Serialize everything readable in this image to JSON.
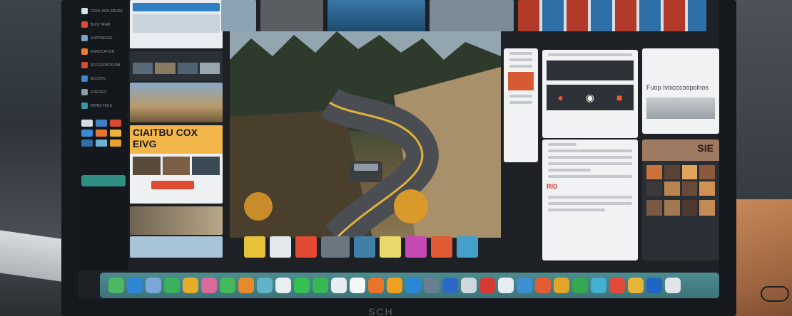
{
  "laptop": {
    "brand_mark": "SCH"
  },
  "left_nav": {
    "items": [
      {
        "label": "COOL HOS ERUSS",
        "color": "#d4e2ee"
      },
      {
        "label": "BUIS TRAM",
        "color": "#e2493a"
      },
      {
        "label": "SUPPRESSE",
        "color": "#7ba4c8"
      },
      {
        "label": "EGNOCATION",
        "color": "#e77d32"
      },
      {
        "label": "SOTGIIONTIFIOM",
        "color": "#d94a32"
      },
      {
        "label": "BOJ BTO",
        "color": "#3e85d0"
      },
      {
        "label": "EOETIEO",
        "color": "#8c9ca8"
      },
      {
        "label": "WONS TEES",
        "color": "#3a98a6"
      }
    ],
    "grid_colors": [
      "#d4dde5",
      "#3e7fc6",
      "#d74a32",
      "#3b8ad4",
      "#e5752f",
      "#ebb53a",
      "#2e6fa8",
      "#6fb0d6",
      "#e9a230"
    ]
  },
  "tiles": {
    "yellow_label": "CIAITBU COX EIVG",
    "right_title": "Fuop Ivoicccoopolnos",
    "red_small": "RID",
    "right_big": "SIE"
  },
  "dock": {
    "icons": [
      {
        "name": "messages-icon",
        "color": "#4cb861"
      },
      {
        "name": "safari-icon",
        "color": "#2f86d6"
      },
      {
        "name": "finder-icon",
        "color": "#7aa6d8"
      },
      {
        "name": "mail-icon",
        "color": "#3bb15b"
      },
      {
        "name": "chrome-icon",
        "color": "#e4ac28"
      },
      {
        "name": "music-icon",
        "color": "#d86a9c"
      },
      {
        "name": "facetime-icon",
        "color": "#45b85a"
      },
      {
        "name": "photos-icon",
        "color": "#e68a2e"
      },
      {
        "name": "notes-icon",
        "color": "#5fb2c8"
      },
      {
        "name": "calendar-icon",
        "color": "#e8eef1"
      },
      {
        "name": "whatsapp-icon",
        "color": "#35c051"
      },
      {
        "name": "spotify-icon",
        "color": "#38b852"
      },
      {
        "name": "docs-icon",
        "color": "#e7eef3"
      },
      {
        "name": "files-icon",
        "color": "#f4f6f7"
      },
      {
        "name": "firefox-icon",
        "color": "#e8752a"
      },
      {
        "name": "vlc-icon",
        "color": "#f0a01f"
      },
      {
        "name": "skype-icon",
        "color": "#2a88d6"
      },
      {
        "name": "settings-icon",
        "color": "#6a7f93"
      },
      {
        "name": "word-icon",
        "color": "#2c68c5"
      },
      {
        "name": "preview-icon",
        "color": "#cfd6dd"
      },
      {
        "name": "acrobat-icon",
        "color": "#d53b32"
      },
      {
        "name": "launchpad-icon",
        "color": "#e9edf1"
      },
      {
        "name": "photoshop-icon",
        "color": "#3e8ed2"
      },
      {
        "name": "maps-icon",
        "color": "#e45c35"
      },
      {
        "name": "slides-icon",
        "color": "#e4a62a"
      },
      {
        "name": "sheets-icon",
        "color": "#35a852"
      },
      {
        "name": "chat-icon",
        "color": "#41b0d4"
      },
      {
        "name": "mail2-icon",
        "color": "#e24a3a"
      },
      {
        "name": "keynote-icon",
        "color": "#e6b437"
      },
      {
        "name": "numbers-icon",
        "color": "#1f66c4"
      },
      {
        "name": "trash-icon",
        "color": "#dfe5ea"
      }
    ]
  }
}
